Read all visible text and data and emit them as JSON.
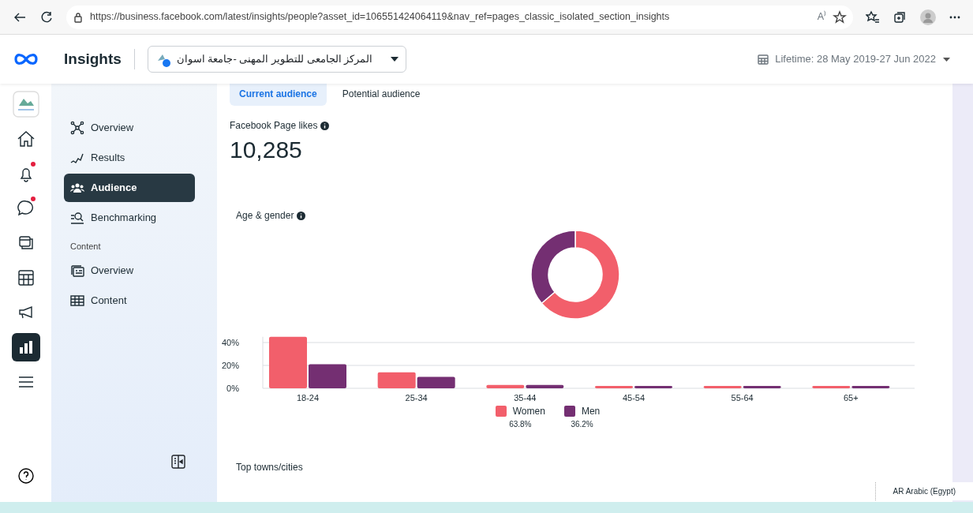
{
  "browser": {
    "url": "https://business.facebook.com/latest/insights/people?asset_id=106551424064119&nav_ref=pages_classic_isolated_section_insights",
    "read_aloud": "A⁾"
  },
  "header": {
    "title": "Insights",
    "page_name": "المركز الجامعى للتطوير المهنى -جامعة اسوان",
    "date_range": "Lifetime: 28 May 2019-27 Jun 2022"
  },
  "rail": [
    {
      "kind": "page",
      "selected": false,
      "badge": false
    },
    {
      "kind": "home",
      "selected": false,
      "badge": false
    },
    {
      "kind": "bell",
      "selected": false,
      "badge": true
    },
    {
      "kind": "chat",
      "selected": false,
      "badge": true
    },
    {
      "kind": "pages",
      "selected": false,
      "badge": false
    },
    {
      "kind": "table",
      "selected": false,
      "badge": false
    },
    {
      "kind": "megaphone",
      "selected": false,
      "badge": false
    },
    {
      "kind": "chart",
      "selected": true,
      "badge": false
    },
    {
      "kind": "menu",
      "selected": false,
      "badge": false
    }
  ],
  "sidebar": {
    "items": [
      {
        "label": "Overview",
        "selected": false
      },
      {
        "label": "Results",
        "selected": false
      },
      {
        "label": "Audience",
        "selected": true
      },
      {
        "label": "Benchmarking",
        "selected": false
      }
    ],
    "section_label": "Content",
    "content_items": [
      {
        "label": "Overview",
        "selected": false
      },
      {
        "label": "Content",
        "selected": false
      }
    ]
  },
  "tabs": [
    {
      "label": "Current audience",
      "selected": true
    },
    {
      "label": "Potential audience",
      "selected": false
    }
  ],
  "likes": {
    "label": "Facebook Page likes",
    "value": "10,285"
  },
  "age_gender": {
    "title": "Age & gender",
    "bars": {
      "chart_data": {
        "type": "bar",
        "categories": [
          "18-24",
          "25-34",
          "35-44",
          "45-54",
          "55-64",
          "65+"
        ],
        "series": [
          {
            "name": "Women",
            "color": "#f25f6b",
            "values": [
              45,
              14,
              3,
              2,
              2,
              2
            ]
          },
          {
            "name": "Men",
            "color": "#742f72",
            "values": [
              21,
              10,
              3,
              2,
              2,
              2
            ]
          }
        ],
        "legend": "bottom",
        "ylim": [
          0,
          45
        ],
        "yticks": [
          {
            "value": 0,
            "label": "0%"
          },
          {
            "value": 20,
            "label": "20%"
          },
          {
            "value": 40,
            "label": "40%"
          }
        ]
      }
    },
    "legend": [
      {
        "share": "63.8%"
      },
      {
        "share": "36.2%"
      }
    ]
  },
  "towns": {
    "title": "Top towns/cities"
  },
  "language_tooltip": "AR Arabic (Egypt)"
}
